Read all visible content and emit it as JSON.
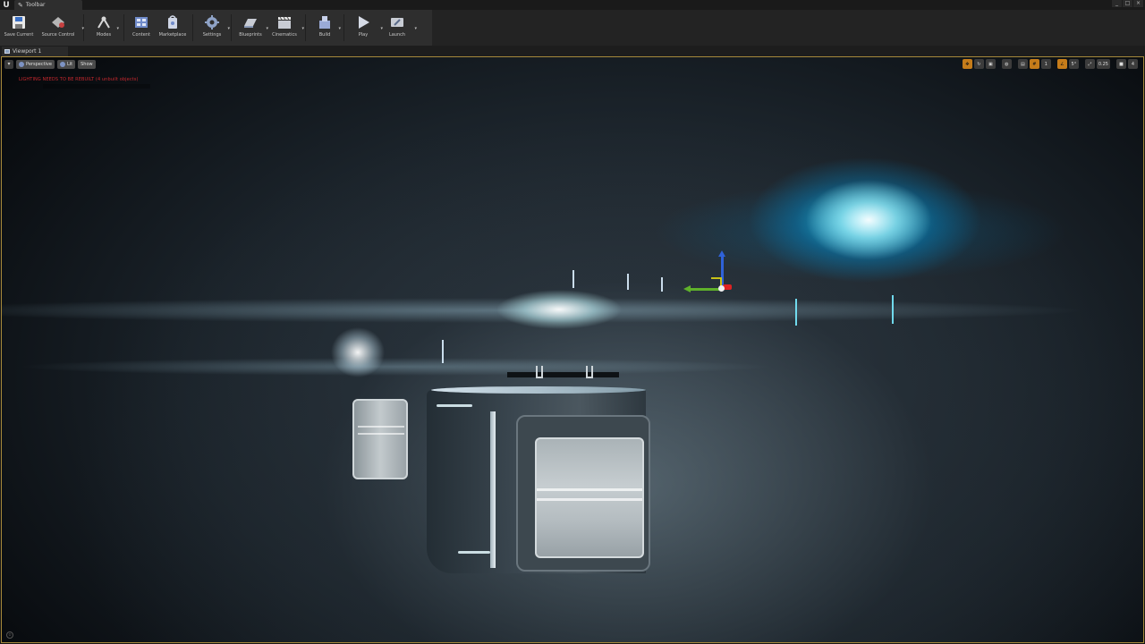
{
  "tab": {
    "label": "Toolbar",
    "icon": "wrench-icon"
  },
  "window_controls": [
    "_",
    "□",
    "×"
  ],
  "toolbar": {
    "buttons": [
      {
        "label": "Save Current",
        "icon": "floppy-disk-icon",
        "dropdown": false
      },
      {
        "label": "Source Control",
        "icon": "source-control-icon",
        "dropdown": true
      },
      {
        "label": "Modes",
        "icon": "modes-icon",
        "dropdown": true
      },
      {
        "label": "Content",
        "icon": "content-browser-icon",
        "dropdown": false
      },
      {
        "label": "Marketplace",
        "icon": "marketplace-icon",
        "dropdown": false
      },
      {
        "label": "Settings",
        "icon": "gear-icon",
        "dropdown": true
      },
      {
        "label": "Blueprints",
        "icon": "blueprints-icon",
        "dropdown": true
      },
      {
        "label": "Cinematics",
        "icon": "clapperboard-icon",
        "dropdown": true
      },
      {
        "label": "Build",
        "icon": "build-icon",
        "dropdown": true
      },
      {
        "label": "Play",
        "icon": "play-icon",
        "dropdown": true
      },
      {
        "label": "Launch",
        "icon": "launch-icon",
        "dropdown": true
      }
    ]
  },
  "viewport": {
    "tab_label": "Viewport 1",
    "view_mode": "Perspective",
    "lighting_mode": "Lit",
    "show_label": "Show",
    "warning": "LIGHTING NEEDS TO BE REBUILT (4 unbuilt objects)",
    "right_controls": {
      "camera_speed": "0.25",
      "camera_count": "4"
    }
  },
  "colors": {
    "accent_border": "#a6893b",
    "warning_red": "#c8282e",
    "gizmo_x": "#dd2222",
    "gizmo_y": "#5fb12b",
    "gizmo_z": "#2f62d9",
    "glow_cyan": "#28d7ff"
  }
}
